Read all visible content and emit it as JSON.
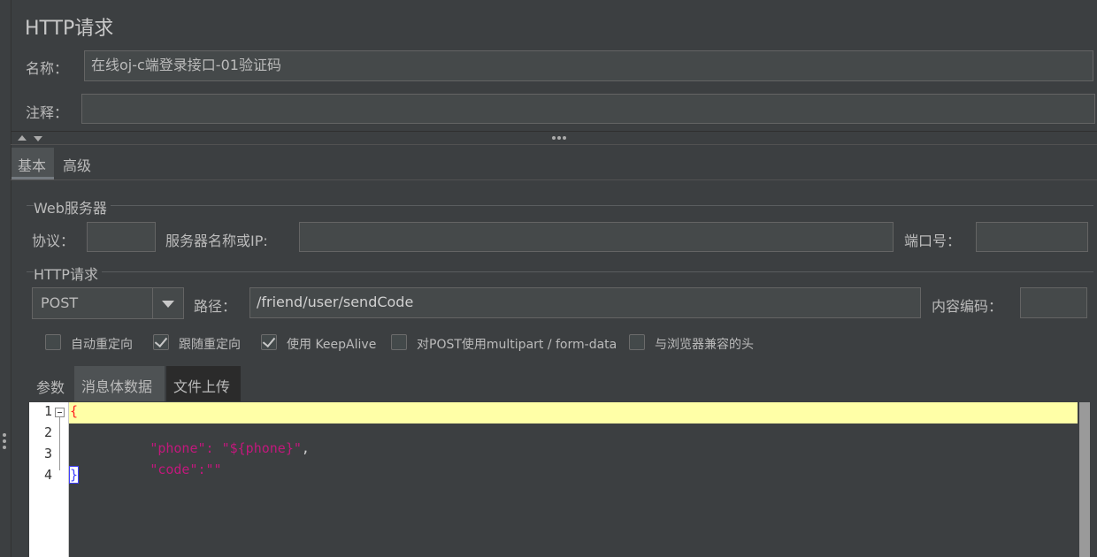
{
  "panel": {
    "title": "HTTP请求",
    "name_label": "名称：",
    "name_value": "在线oj-c端登录接口-01验证码",
    "comment_label": "注释：",
    "comment_value": ""
  },
  "tabs": [
    {
      "label": "基本",
      "active": true
    },
    {
      "label": "高级",
      "active": false
    }
  ],
  "web_server": {
    "group_title": "Web服务器",
    "protocol_label": "协议：",
    "protocol_value": "",
    "server_label": "服务器名称或IP:",
    "server_value": "",
    "port_label": "端口号：",
    "port_value": ""
  },
  "http_request": {
    "group_title": "HTTP请求",
    "method": "POST",
    "path_label": "路径：",
    "path_value": "/friend/user/sendCode",
    "encoding_label": "内容编码：",
    "encoding_value": ""
  },
  "options": [
    {
      "label": "自动重定向",
      "checked": false
    },
    {
      "label": "跟随重定向",
      "checked": true
    },
    {
      "label": "使用 KeepAlive",
      "checked": true
    },
    {
      "label": "对POST使用multipart / form-data",
      "checked": false
    },
    {
      "label": "与浏览器兼容的头",
      "checked": false
    }
  ],
  "body_tabs": [
    {
      "label": "参数",
      "active": false
    },
    {
      "label": "消息体数据",
      "active": true
    },
    {
      "label": "文件上传",
      "active": false
    }
  ],
  "editor": {
    "line_numbers": [
      "1",
      "2",
      "3",
      "4"
    ],
    "line1_brace": "{",
    "line2_key": "\"phone\"",
    "line2_colon": ": ",
    "line2_value": "\"${phone}\"",
    "line2_comma": ",",
    "line3_key": "\"code\"",
    "line3_colon": ":",
    "line3_value": "\"\"",
    "line4_brace": "}"
  },
  "colors": {
    "background": "#3c3f41",
    "field_bg": "#45494a",
    "current_line": "#ffffa7",
    "json_string": "#c2187c",
    "json_brace": "#ff0000"
  }
}
